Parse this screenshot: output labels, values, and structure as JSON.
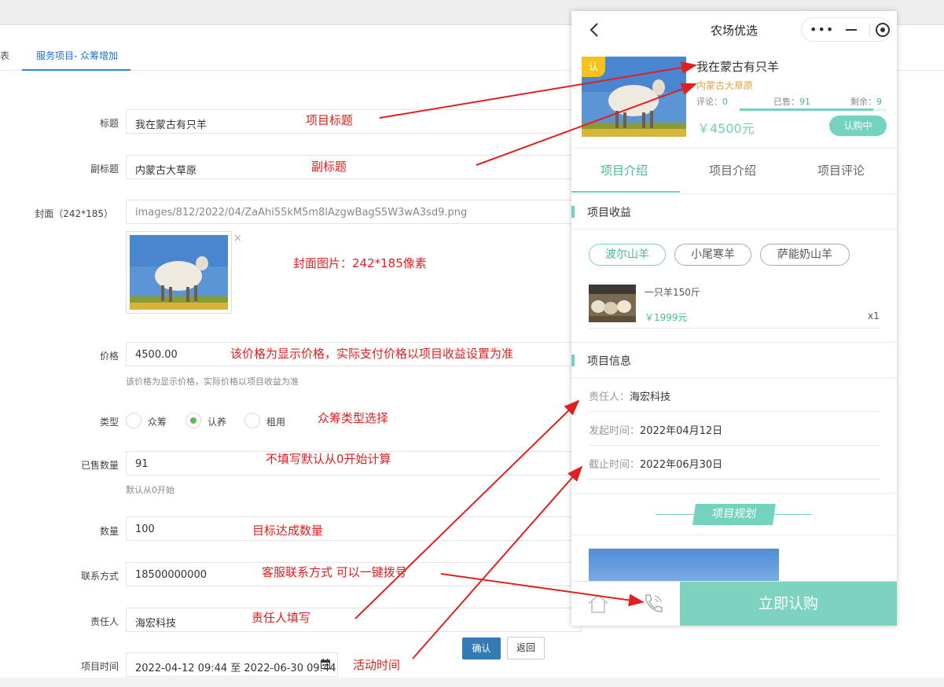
{
  "tabs": {
    "partial": "表",
    "active": "服务项目- 众筹增加"
  },
  "form": {
    "title_label": "标题",
    "title_value": "我在蒙古有只羊",
    "subtitle_label": "副标题",
    "subtitle_value": "内蒙古大草原",
    "cover_label": "封面（242*185）",
    "cover_value": "images/812/2022/04/ZaAhi55kM5m8lAzgwBagS5W3wA3sd9.png",
    "remove_symbol": "×",
    "price_label": "价格",
    "price_value": "4500.00",
    "price_hint": "该价格为显示价格，实际价格以项目收益为准",
    "type_label": "类型",
    "type_options": [
      "众筹",
      "认养",
      "租用"
    ],
    "type_selected": "认养",
    "sold_label": "已售数量",
    "sold_value": "91",
    "sold_hint": "默认从0开始",
    "qty_label": "数量",
    "qty_value": "100",
    "contact_label": "联系方式",
    "contact_value": "18500000000",
    "owner_label": "责任人",
    "owner_value": "海宏科技",
    "time_label": "项目时间",
    "time_value": "2022-04-12 09:44 至 2022-06-30 09:44",
    "confirm_label": "确认",
    "back_label": "返回"
  },
  "annotations": {
    "title": "项目标题",
    "subtitle": "副标题",
    "cover": "封面图片：242*185像素",
    "price": "该价格为显示价格，实际支付价格以项目收益设置为准",
    "type": "众筹类型选择",
    "sold": "不填写默认从0开始计算",
    "qty": "目标达成数量",
    "contact": "客服联系方式  可以一键拨号",
    "owner": "责任人填写",
    "time": "活动时间"
  },
  "phone": {
    "title": "农场优选",
    "badge": "认",
    "product_title": "我在蒙古有只羊",
    "product_subtitle": "内蒙古大草原",
    "reviews_label": "评论：",
    "reviews_value": "0",
    "sold_label": "已售：",
    "sold_value": "91",
    "remain_label": "剩余：",
    "remain_value": "9",
    "progress": 0.91,
    "price": "￥4500元",
    "status": "认购中",
    "tabs": [
      "项目介绍",
      "项目介绍",
      "项目评论"
    ],
    "section_income": "项目收益",
    "chips": [
      "波尔山羊",
      "小尾寒羊",
      "萨能奶山羊"
    ],
    "item_name": "一只羊150斤",
    "item_price": "￥1999元",
    "item_qty": "x1",
    "section_info": "项目信息",
    "owner_label": "责任人：",
    "owner_value": "海宏科技",
    "start_label": "发起时间：",
    "start_value": "2022年04月12日",
    "end_label": "截止时间：",
    "end_value": "2022年06月30日",
    "plan_title": "项目规划",
    "buy_button": "立即认购"
  },
  "colors": {
    "accent": "#74d3be",
    "annotation": "#e02020",
    "primary_button": "#337ab7"
  }
}
